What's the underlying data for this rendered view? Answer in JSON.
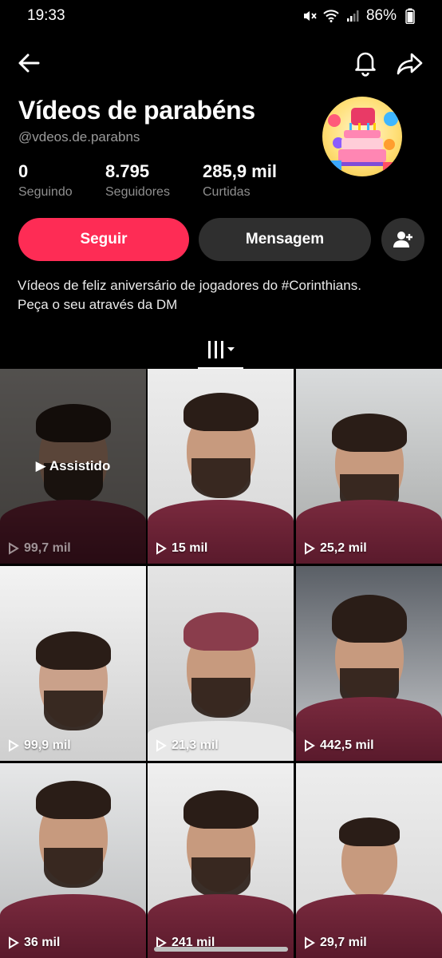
{
  "status_bar": {
    "time": "19:33",
    "battery": "86%"
  },
  "top_bar": {
    "back_icon": "arrow-left-icon",
    "bell_icon": "bell-icon",
    "share_icon": "share-icon"
  },
  "profile": {
    "name": "Vídeos de parabéns",
    "handle": "@vdeos.de.parabns",
    "avatar_icon": "birthday-cake-avatar",
    "stats": [
      {
        "value": "0",
        "label": "Seguindo"
      },
      {
        "value": "8.795",
        "label": "Seguidores"
      },
      {
        "value": "285,9 mil",
        "label": "Curtidas"
      }
    ],
    "follow_label": "Seguir",
    "message_label": "Mensagem",
    "bio_line1": "Vídeos de feliz aniversário de jogadores do #Corinthians.",
    "bio_line2": "Peça o seu através da DM"
  },
  "colors": {
    "accent": "#fe2c55",
    "button_dark": "#2f2f2f",
    "background": "#000000"
  },
  "videos": [
    {
      "views": "99,7 mil",
      "watched_label": "Assistido"
    },
    {
      "views": "15 mil"
    },
    {
      "views": "25,2 mil"
    },
    {
      "views": "99,9 mil"
    },
    {
      "views": "21,3 mil"
    },
    {
      "views": "442,5 mil"
    },
    {
      "views": "36 mil"
    },
    {
      "views": "241 mil"
    },
    {
      "views": "29,7 mil"
    }
  ]
}
